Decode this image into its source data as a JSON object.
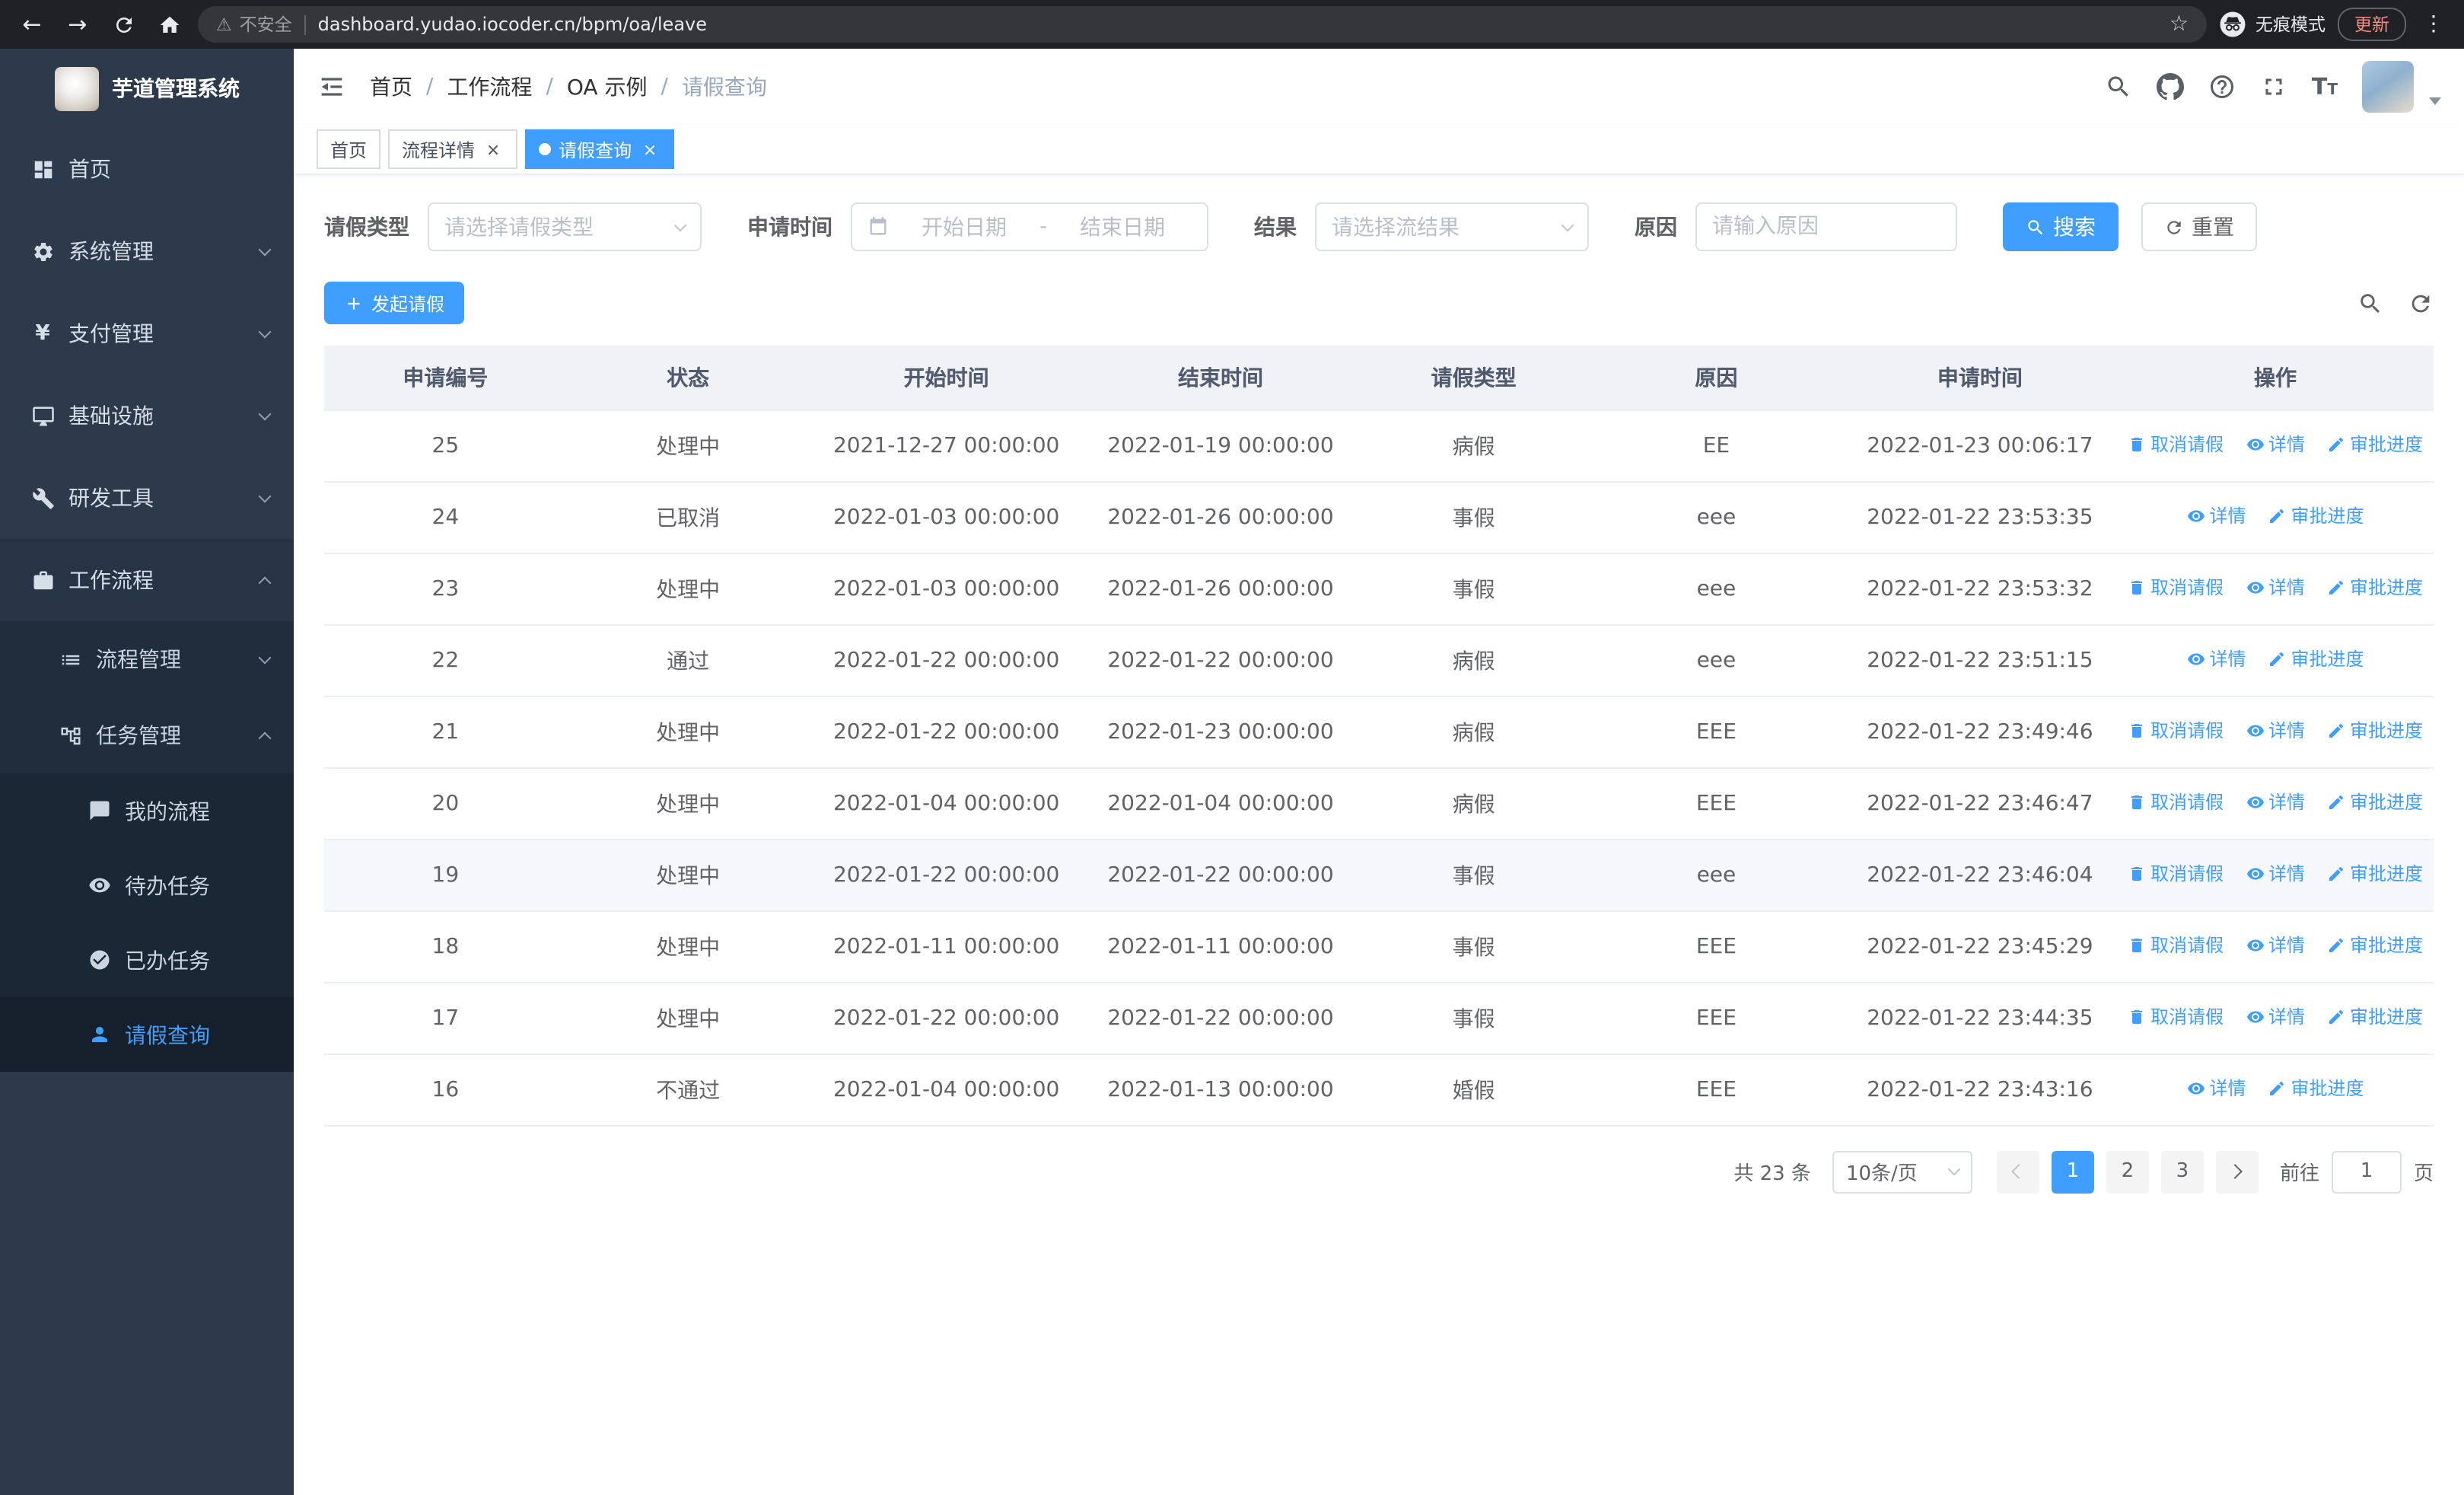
{
  "icons": {
    "back": "←",
    "forward": "→",
    "star": "☆",
    "more": "⋮",
    "warning": "⚠",
    "close": "×",
    "yen": "¥",
    "font_big": "T",
    "font_small": "T"
  },
  "browser": {
    "security_chip": "不安全",
    "url": "dashboard.yudao.iocoder.cn/bpm/oa/leave",
    "incognito_label": "无痕模式",
    "update_button": "更新"
  },
  "sidebar": {
    "app_title": "芋道管理系统",
    "items": [
      {
        "label": "首页"
      },
      {
        "label": "系统管理"
      },
      {
        "label": "支付管理"
      },
      {
        "label": "基础设施"
      },
      {
        "label": "研发工具"
      },
      {
        "label": "工作流程"
      }
    ],
    "workflow_submenu": [
      {
        "label": "流程管理"
      },
      {
        "label": "任务管理"
      }
    ],
    "task_submenu": [
      {
        "label": "我的流程"
      },
      {
        "label": "待办任务"
      },
      {
        "label": "已办任务"
      },
      {
        "label": "请假查询"
      }
    ]
  },
  "header": {
    "breadcrumb": [
      "首页",
      "工作流程",
      "OA 示例",
      "请假查询"
    ],
    "breadcrumb_separator": "/"
  },
  "tabs": [
    {
      "label": "首页"
    },
    {
      "label": "流程详情"
    },
    {
      "label": "请假查询"
    }
  ],
  "filters": {
    "leave_type_label": "请假类型",
    "leave_type_placeholder": "请选择请假类型",
    "apply_time_label": "申请时间",
    "start_date_placeholder": "开始日期",
    "range_separator": "-",
    "end_date_placeholder": "结束日期",
    "result_label": "结果",
    "result_placeholder": "请选择流结果",
    "reason_label": "原因",
    "reason_placeholder": "请输入原因",
    "search_button": "搜索",
    "reset_button": "重置"
  },
  "toolbar": {
    "create_button": "发起请假"
  },
  "table": {
    "columns": [
      "申请编号",
      "状态",
      "开始时间",
      "结束时间",
      "请假类型",
      "原因",
      "申请时间",
      "操作"
    ],
    "action_labels": {
      "cancel": "取消请假",
      "detail": "详情",
      "progress": "审批进度"
    },
    "rows": [
      {
        "id": "25",
        "status": "处理中",
        "start": "2021-12-27 00:00:00",
        "end": "2022-01-19 00:00:00",
        "type": "病假",
        "reason": "EE",
        "apply_time": "2022-01-23 00:06:17",
        "can_cancel": true,
        "highlighted": false
      },
      {
        "id": "24",
        "status": "已取消",
        "start": "2022-01-03 00:00:00",
        "end": "2022-01-26 00:00:00",
        "type": "事假",
        "reason": "eee",
        "apply_time": "2022-01-22 23:53:35",
        "can_cancel": false,
        "highlighted": false
      },
      {
        "id": "23",
        "status": "处理中",
        "start": "2022-01-03 00:00:00",
        "end": "2022-01-26 00:00:00",
        "type": "事假",
        "reason": "eee",
        "apply_time": "2022-01-22 23:53:32",
        "can_cancel": true,
        "highlighted": false
      },
      {
        "id": "22",
        "status": "通过",
        "start": "2022-01-22 00:00:00",
        "end": "2022-01-22 00:00:00",
        "type": "病假",
        "reason": "eee",
        "apply_time": "2022-01-22 23:51:15",
        "can_cancel": false,
        "highlighted": false
      },
      {
        "id": "21",
        "status": "处理中",
        "start": "2022-01-22 00:00:00",
        "end": "2022-01-23 00:00:00",
        "type": "病假",
        "reason": "EEE",
        "apply_time": "2022-01-22 23:49:46",
        "can_cancel": true,
        "highlighted": false
      },
      {
        "id": "20",
        "status": "处理中",
        "start": "2022-01-04 00:00:00",
        "end": "2022-01-04 00:00:00",
        "type": "病假",
        "reason": "EEE",
        "apply_time": "2022-01-22 23:46:47",
        "can_cancel": true,
        "highlighted": false
      },
      {
        "id": "19",
        "status": "处理中",
        "start": "2022-01-22 00:00:00",
        "end": "2022-01-22 00:00:00",
        "type": "事假",
        "reason": "eee",
        "apply_time": "2022-01-22 23:46:04",
        "can_cancel": true,
        "highlighted": true
      },
      {
        "id": "18",
        "status": "处理中",
        "start": "2022-01-11 00:00:00",
        "end": "2022-01-11 00:00:00",
        "type": "事假",
        "reason": "EEE",
        "apply_time": "2022-01-22 23:45:29",
        "can_cancel": true,
        "highlighted": false
      },
      {
        "id": "17",
        "status": "处理中",
        "start": "2022-01-22 00:00:00",
        "end": "2022-01-22 00:00:00",
        "type": "事假",
        "reason": "EEE",
        "apply_time": "2022-01-22 23:44:35",
        "can_cancel": true,
        "highlighted": false
      },
      {
        "id": "16",
        "status": "不通过",
        "start": "2022-01-04 00:00:00",
        "end": "2022-01-13 00:00:00",
        "type": "婚假",
        "reason": "EEE",
        "apply_time": "2022-01-22 23:43:16",
        "can_cancel": false,
        "highlighted": false
      }
    ]
  },
  "pagination": {
    "total_text": "共 23 条",
    "page_size": "10条/页",
    "pages": [
      "1",
      "2",
      "3"
    ],
    "goto_label": "前往",
    "goto_value": "1",
    "page_label": "页"
  },
  "colors": {
    "primary": "#409eff",
    "sidebar_bg": "#2d3a4b"
  }
}
